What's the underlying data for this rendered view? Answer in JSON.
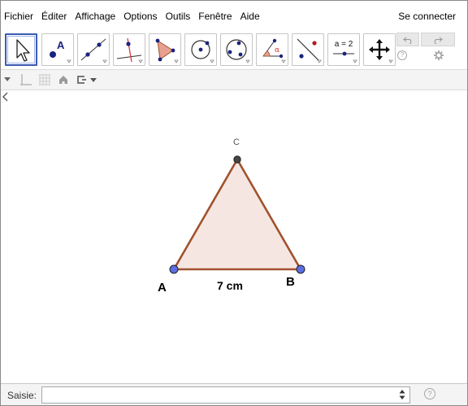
{
  "menubar": {
    "items": [
      "Fichier",
      "Éditer",
      "Affichage",
      "Options",
      "Outils",
      "Fenêtre",
      "Aide"
    ],
    "login": "Se connecter"
  },
  "toolbar": {
    "tools": [
      {
        "name": "move-tool",
        "icon": "arrow-pointer-icon"
      },
      {
        "name": "point-tool",
        "icon": "point-a-icon",
        "glyph": "A"
      },
      {
        "name": "line-tool",
        "icon": "line-through-points-icon"
      },
      {
        "name": "perpendicular-tool",
        "icon": "perpendicular-line-icon"
      },
      {
        "name": "polygon-tool",
        "icon": "polygon-icon"
      },
      {
        "name": "circle-tool",
        "icon": "circle-center-point-icon"
      },
      {
        "name": "circle-three-points-tool",
        "icon": "circle-three-points-icon"
      },
      {
        "name": "angle-tool",
        "icon": "angle-icon",
        "glyph": "α"
      },
      {
        "name": "reflect-tool",
        "icon": "reflect-line-icon"
      },
      {
        "name": "slider-tool",
        "icon": "slider-icon",
        "glyph": "a = 2"
      },
      {
        "name": "move-view-tool",
        "icon": "move-arrows-icon"
      }
    ],
    "help_glyph": "?"
  },
  "graphics": {
    "points": {
      "A": "A",
      "B": "B",
      "C": "C"
    },
    "segment_label": "7 cm",
    "colors": {
      "triangle_fill": "#f5e6e2",
      "triangle_stroke": "#a0522d",
      "base_point": "#5b6ee1",
      "apex_point": "#444444"
    }
  },
  "inputbar": {
    "label": "Saisie:",
    "value": "",
    "help_glyph": "?"
  }
}
